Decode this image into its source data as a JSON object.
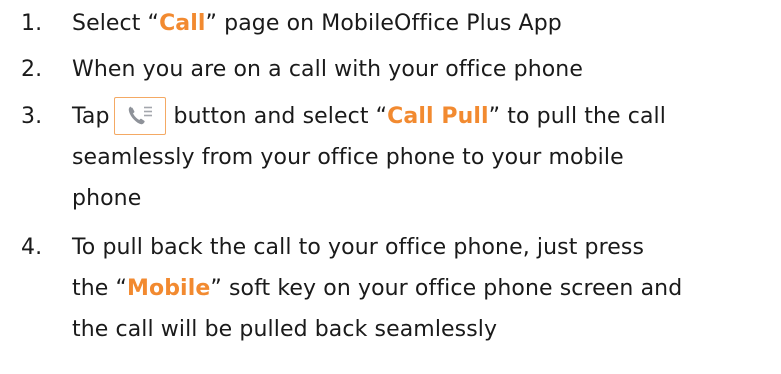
{
  "steps": [
    {
      "number": "1.",
      "before": "Select “",
      "highlight": "Call",
      "after": "” page on MobileOffice Plus App"
    },
    {
      "number": "2.",
      "text": "When you are on a call with your office phone"
    },
    {
      "number": "3.",
      "before_button": "Tap",
      "button_icon": "phone-list-icon",
      "after_button": "button and select “",
      "highlight": "Call Pull",
      "line1_end": "” to pull the call",
      "line2": "seamlessly from your office phone to your mobile",
      "line3": "phone"
    },
    {
      "number": "4.",
      "line1": "To pull back the call to your office phone, just press",
      "line2_before": "the “",
      "highlight": "Mobile",
      "line2_after": "” soft key on your office phone screen and",
      "line3": "the call will be pulled back seamlessly"
    }
  ],
  "colors": {
    "highlight": "#f28a30",
    "button_border": "#f4a964",
    "text": "#1a1a1a"
  }
}
